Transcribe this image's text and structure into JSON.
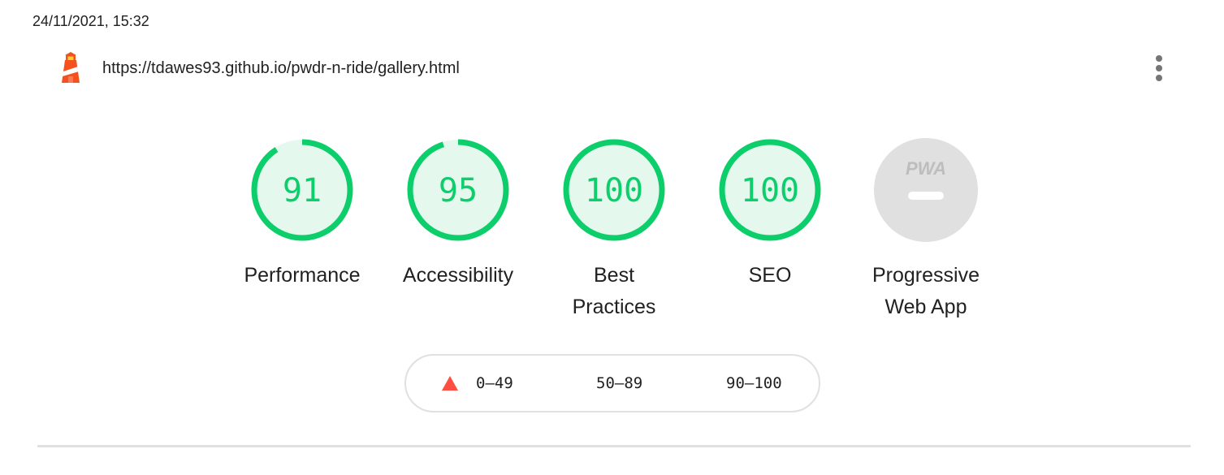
{
  "report": {
    "timestamp": "24/11/2021, 15:32",
    "url": "https://tdawes93.github.io/pwdr-n-ride/gallery.html"
  },
  "colors": {
    "pass": "#0cce6b",
    "pass_bg": "#e5f8ee",
    "fail": "#ff4e42",
    "pwa_gray": "#e0e0e0",
    "pwa_text": "#bdbdbd",
    "text": "#212121"
  },
  "gauges": [
    {
      "label": "Performance",
      "score": 91,
      "display": "91"
    },
    {
      "label": "Accessibility",
      "score": 95,
      "display": "95"
    },
    {
      "label": "Best Practices",
      "score": 100,
      "display": "100"
    },
    {
      "label": "SEO",
      "score": 100,
      "display": "100"
    }
  ],
  "pwa": {
    "label": "Progressive Web App",
    "badge": "PWA"
  },
  "legend": {
    "fail": "0–49",
    "average": "50–89",
    "pass": "90–100"
  },
  "icons": {
    "logo": "lighthouse-icon",
    "menu": "more-vertical-icon",
    "fail": "triangle-icon"
  }
}
